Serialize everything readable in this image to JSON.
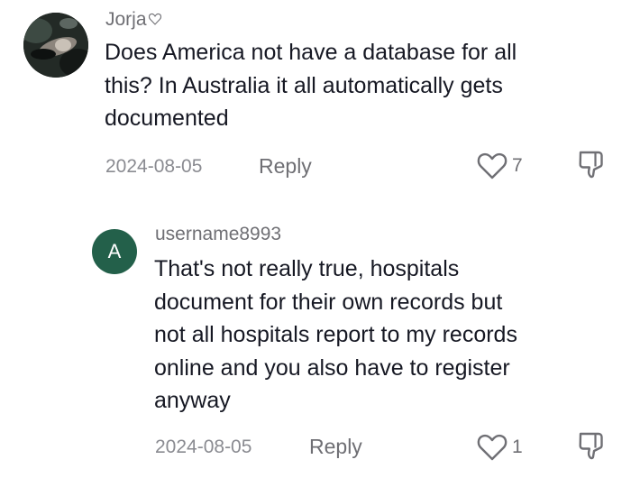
{
  "comments": [
    {
      "username": "Jorja",
      "username_icon": "heart-outline-icon",
      "text_lines": [
        "Does America not have a database for all",
        "this? In Australia it all automatically gets",
        "documented"
      ],
      "date": "2024-08-05",
      "reply_label": "Reply",
      "like_count": "7",
      "like_icon": "heart-outline-icon",
      "dislike_icon": "thumbs-down-icon"
    }
  ],
  "replies": [
    {
      "avatar_letter": "A",
      "avatar_color": "#23604a",
      "username": "username8993",
      "text_lines": [
        "That's not really true, hospitals",
        "document for their own records but",
        "not all hospitals report to my records",
        "online and you also have to register",
        "anyway"
      ],
      "date": "2024-08-05",
      "reply_label": "Reply",
      "like_count": "1",
      "like_icon": "heart-outline-icon",
      "dislike_icon": "thumbs-down-icon"
    }
  ]
}
